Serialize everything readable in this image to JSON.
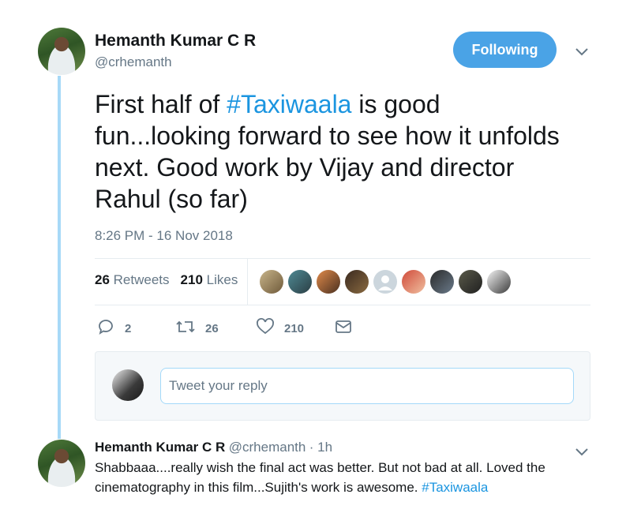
{
  "tweet": {
    "author_name": "Hemanth Kumar C R",
    "handle": "@crhemanth",
    "follow_label": "Following",
    "text_prefix": "First half of ",
    "hashtag": "#Taxiwaala",
    "text_suffix": " is good fun...looking forward to see how it unfolds next. Good work by Vijay and director Rahul (so far)",
    "timestamp": "8:26 PM - 16 Nov 2018",
    "retweets_count": "26",
    "retweets_label": "Retweets",
    "likes_count": "210",
    "likes_label": "Likes",
    "likers_count": 9,
    "actions": {
      "replies": "2",
      "retweets": "26",
      "likes": "210"
    }
  },
  "reply_composer": {
    "placeholder": "Tweet your reply"
  },
  "reply": {
    "author_name": "Hemanth Kumar C R",
    "handle": "@crhemanth",
    "time": "· 1h",
    "text": "Shabbaaa....really wish the final act was better. But not bad at all. Loved the cinematography in this film...Sujith's work is awesome. ",
    "hashtag": "#Taxiwaala"
  },
  "colors": {
    "accent": "#1b95e0",
    "follow_button": "#4aa3e6",
    "thread_line": "#a7d9f7"
  },
  "icons": [
    "chevron-down-icon",
    "reply-icon",
    "retweet-icon",
    "heart-icon",
    "message-icon"
  ]
}
